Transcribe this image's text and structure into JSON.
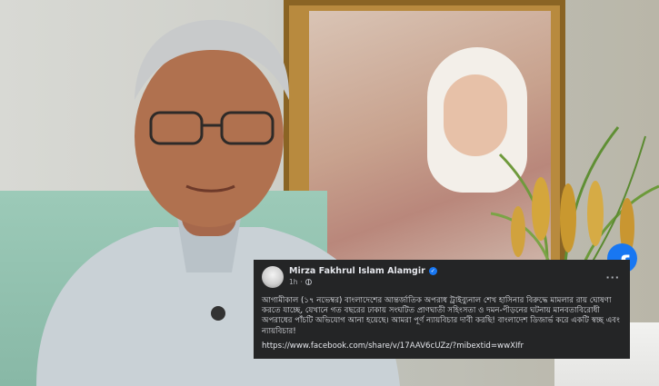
{
  "post": {
    "author": "Mirza Fakhrul Islam Alamgir",
    "time": "1h",
    "separator": "·",
    "more": "···",
    "text": "আগামীকাল (১৭ নভেম্বর) বাংলাদেশের আন্তর্জাতিক অপরাধ ট্রাইব্যুনাল শেখ হাসিনার বিরুদ্ধে মামলার রায় ঘোষণা করতে যাচ্ছে, যেখানে গত বছরের ঢাকায় সংঘটিত প্রাণঘাতী সহিংসতা ও দমন-পীড়নের ঘটনায় মানবতাবিরোধী অপরাধের পাঁচটি অভিযোগ আনা হয়েছে। আমরা পূর্ণ ন্যায়বিচার দাবী করছি! বাংলাদেশ ডিজার্ভ করে একটি স্বচ্ছ এবং ন্যায়বিচার!",
    "link": "https://www.facebook.com/share/v/17AAV6cUZz/?mibextid=wwXIfr"
  },
  "brand": {
    "name": "facebook",
    "glyph": "f",
    "color": "#1877f2"
  },
  "icons": {
    "verified": "verified-badge-icon",
    "audience": "globe-icon",
    "more": "more-options-icon",
    "brand": "facebook-logo-icon"
  }
}
